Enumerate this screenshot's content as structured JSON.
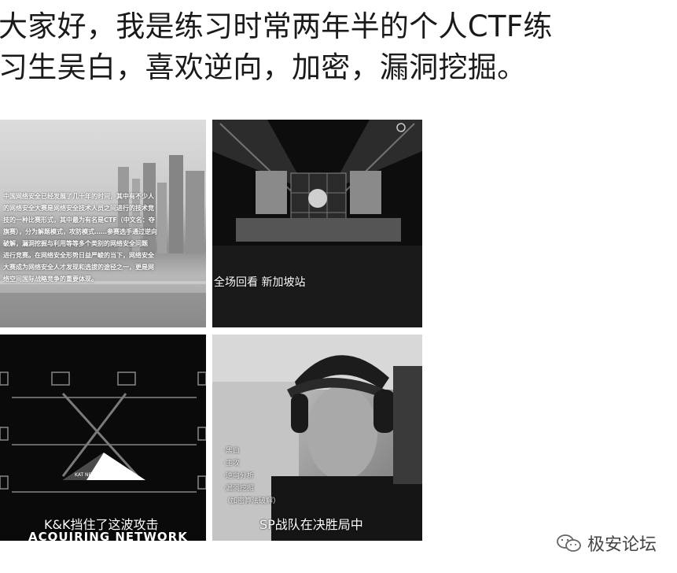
{
  "intro": {
    "line1": "大家好，我是练习时常两年半的个人CTF练",
    "line2": "习生吴白，喜欢逆向，加密，漏洞挖掘。"
  },
  "tiles": {
    "t1": {
      "overlay_lines": [
        "中国网络安全已经发展了几十年的时间，其中有不少人",
        "的网络安全大赛是网络安全技术人员之间进行的技术竞",
        "技的一种比赛形式，其中最为有名是CTF（中文名：夺",
        "旗赛），分为解题模式，攻防模式……参赛选手通过逆向",
        "破解，漏洞挖掘与利用等等多个类别的网络安全问题",
        "进行竞赛。在网络安全形势日益严峻的当下，网络安全",
        "大赛成为网络安全人才发现和选拔的途径之一，更是网",
        "络空间国际战略竞争的重要体现。"
      ]
    },
    "t2": {
      "caption": "全场回看 新加坡站"
    },
    "t3": {
      "caption1": "K&K挡住了这波攻击",
      "caption2": "ACQUIRING NETWORK",
      "badge": "KAT NETWORK"
    },
    "t4": {
      "list": [
        "·黑白",
        "·主攻",
        "·逆向分析",
        "·漏洞挖掘",
        "（加密算法破解）"
      ],
      "caption": "SP战队在决胜局中"
    }
  },
  "watermark": {
    "text": "极安论坛",
    "icon": "wechat-icon"
  }
}
